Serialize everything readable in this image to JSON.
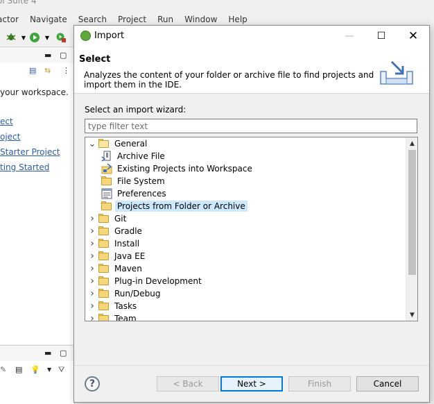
{
  "ide": {
    "title": "ol Suite 4",
    "menu": [
      "actor",
      "Navigate",
      "Search",
      "Project",
      "Run",
      "Window",
      "Help"
    ],
    "welcome_text": "your workspace.",
    "links": [
      "ect",
      "oject",
      " Starter Project",
      "ting Started "
    ]
  },
  "dialog": {
    "title": "Import",
    "page_title": "Select",
    "description": "Analyzes the content of your folder or archive file to find projects and import them in the IDE.",
    "wizard_label": "Select an import wizard:",
    "filter": {
      "placeholder": "type filter text",
      "value": ""
    },
    "tree": [
      {
        "label": "General",
        "level": 0,
        "expanded": true,
        "icon": "folder-open-icon"
      },
      {
        "label": "Archive File",
        "level": 1,
        "icon": "archive-file-icon"
      },
      {
        "label": "Existing Projects into Workspace",
        "level": 1,
        "icon": "existing-projects-icon"
      },
      {
        "label": "File System",
        "level": 1,
        "icon": "folder-icon"
      },
      {
        "label": "Preferences",
        "level": 1,
        "icon": "preferences-icon"
      },
      {
        "label": "Projects from Folder or Archive",
        "level": 1,
        "icon": "folder-icon",
        "selected": true
      },
      {
        "label": "Git",
        "level": 0,
        "expanded": false,
        "icon": "folder-icon"
      },
      {
        "label": "Gradle",
        "level": 0,
        "expanded": false,
        "icon": "folder-icon"
      },
      {
        "label": "Install",
        "level": 0,
        "expanded": false,
        "icon": "folder-icon"
      },
      {
        "label": "Java EE",
        "level": 0,
        "expanded": false,
        "icon": "folder-icon"
      },
      {
        "label": "Maven",
        "level": 0,
        "expanded": false,
        "icon": "folder-icon"
      },
      {
        "label": "Plug-in Development",
        "level": 0,
        "expanded": false,
        "icon": "folder-icon"
      },
      {
        "label": "Run/Debug",
        "level": 0,
        "expanded": false,
        "icon": "folder-icon"
      },
      {
        "label": "Tasks",
        "level": 0,
        "expanded": false,
        "icon": "folder-icon"
      },
      {
        "label": "Team",
        "level": 0,
        "expanded": false,
        "icon": "folder-icon"
      }
    ],
    "buttons": {
      "back": "< Back",
      "next": "Next >",
      "finish": "Finish",
      "cancel": "Cancel"
    },
    "help_symbol": "?"
  },
  "colors": {
    "selection": "#cce8ff",
    "default_button_border": "#0078d7",
    "link": "#2a5db0"
  }
}
